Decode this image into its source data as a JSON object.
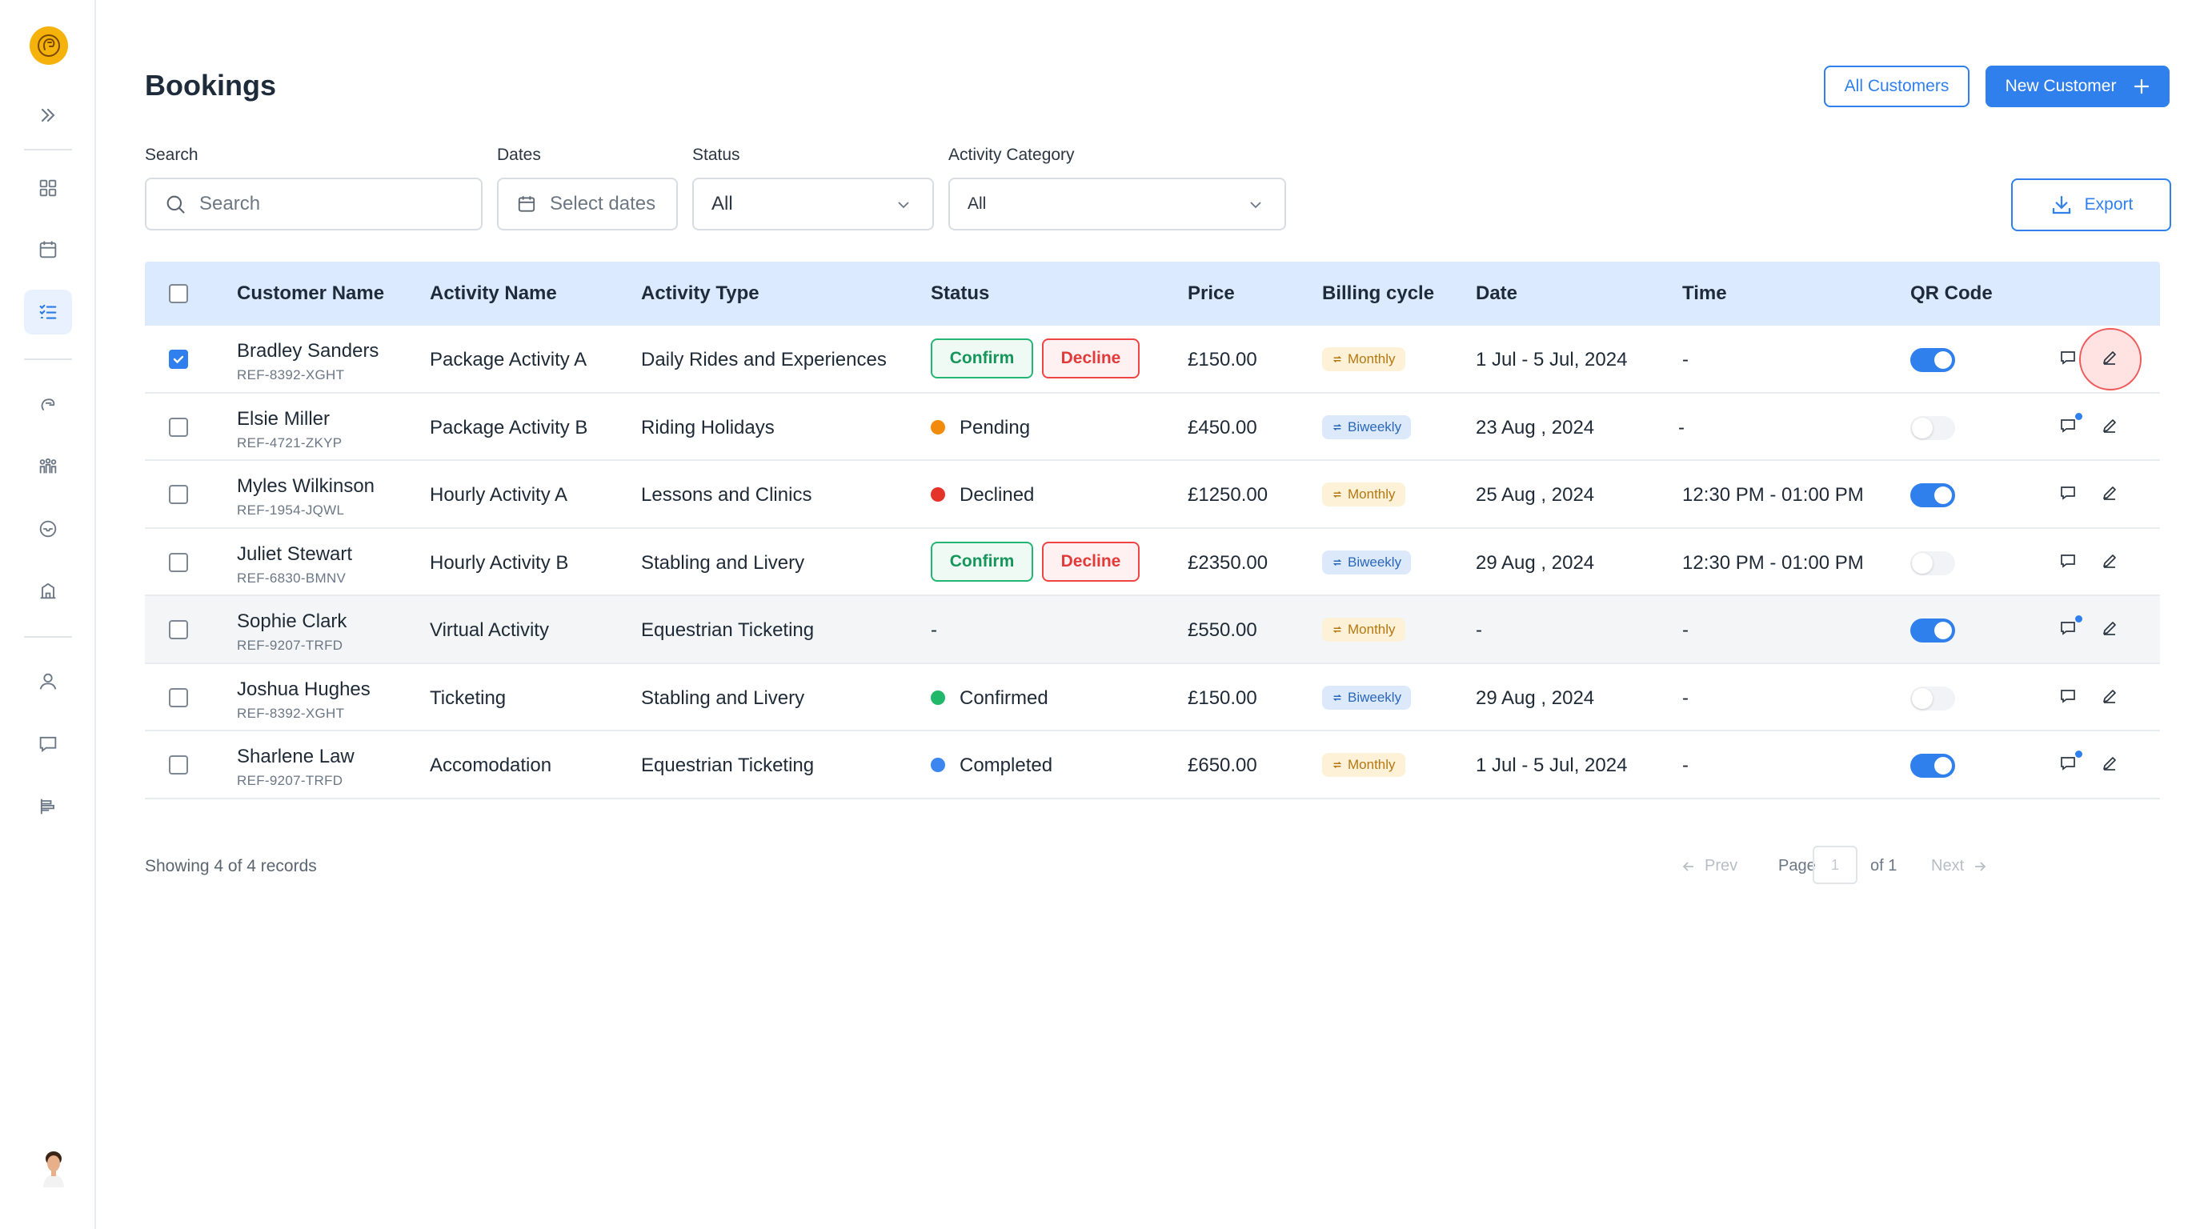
{
  "sidebar": {
    "items": [
      {
        "icon": "expand-icon"
      },
      {
        "icon": "dashboard-icon"
      },
      {
        "icon": "calendar-icon"
      },
      {
        "icon": "bookings-list-icon",
        "active": true
      },
      {
        "icon": "horse-icon"
      },
      {
        "icon": "people-group-icon"
      },
      {
        "icon": "inbox-icon"
      },
      {
        "icon": "building-icon"
      },
      {
        "icon": "user-icon"
      },
      {
        "icon": "message-icon"
      },
      {
        "icon": "reports-icon"
      }
    ]
  },
  "header": {
    "title": "Bookings",
    "all_customers_label": "All Customers",
    "new_customer_label": "New Customer"
  },
  "filters": {
    "search_label": "Search",
    "search_placeholder": "Search",
    "dates_label": "Dates",
    "dates_placeholder": "Select dates",
    "status_label": "Status",
    "status_value": "All",
    "category_label": "Activity Category",
    "category_value": "All",
    "export_label": "Export"
  },
  "table": {
    "columns": [
      "Customer Name",
      "Activity Name",
      "Activity Type",
      "Status",
      "Price",
      "Billing cycle",
      "Date",
      "Time",
      "QR Code"
    ],
    "confirm_label": "Confirm",
    "decline_label": "Decline",
    "rows": [
      {
        "name": "Bradley Sanders",
        "ref": "REF-8392-XGHT",
        "activity": "Package Activity A",
        "type": "Daily Rides and Experiences",
        "status": "action",
        "price": "£150.00",
        "billing": "Monthly",
        "date": "1 Jul - 5 Jul, 2024",
        "time": "-",
        "qr": true,
        "checked": true,
        "note": false
      },
      {
        "name": "Elsie Miller",
        "ref": "REF-4721-ZKYP",
        "activity": "Package Activity B",
        "type": "Riding Holidays",
        "status": "Pending",
        "price": "£450.00",
        "billing": "Biweekly",
        "date": "23 Aug , 2024",
        "time": "-",
        "qr": false,
        "checked": false,
        "note": true
      },
      {
        "name": "Myles Wilkinson",
        "ref": "REF-1954-JQWL",
        "activity": "Hourly Activity A",
        "type": "Lessons and Clinics",
        "status": "Declined",
        "price": "£1250.00",
        "billing": "Monthly",
        "date": "25 Aug , 2024",
        "time": "12:30 PM - 01:00 PM",
        "qr": true,
        "checked": false,
        "note": false
      },
      {
        "name": "Juliet Stewart",
        "ref": "REF-6830-BMNV",
        "activity": "Hourly Activity B",
        "type": "Stabling and Livery",
        "status": "action",
        "price": "£2350.00",
        "billing": "Biweekly",
        "date": "29 Aug , 2024",
        "time": "12:30 PM - 01:00 PM",
        "qr": false,
        "checked": false,
        "note": false
      },
      {
        "name": "Sophie Clark",
        "ref": "REF-9207-TRFD",
        "activity": "Virtual Activity",
        "type": "Equestrian Ticketing",
        "status": "-",
        "price": "£550.00",
        "billing": "Monthly",
        "date": "-",
        "time": "-",
        "qr": true,
        "checked": false,
        "note": true
      },
      {
        "name": "Joshua Hughes",
        "ref": "REF-8392-XGHT",
        "activity": "Ticketing",
        "type": "Stabling and Livery",
        "status": "Confirmed",
        "price": "£150.00",
        "billing": "Biweekly",
        "date": "29 Aug , 2024",
        "time": "-",
        "qr": false,
        "checked": false,
        "note": false
      },
      {
        "name": "Sharlene Law",
        "ref": "REF-9207-TRFD",
        "activity": "Accomodation",
        "type": "Equestrian Ticketing",
        "status": "Completed",
        "price": "£650.00",
        "billing": "Monthly",
        "date": "1 Jul - 5 Jul, 2024",
        "time": "-",
        "qr": true,
        "checked": false,
        "note": true
      }
    ]
  },
  "status_colors": {
    "Pending": "#f28a0c",
    "Declined": "#e5332a",
    "Confirmed": "#22b86a",
    "Completed": "#3b86ef"
  },
  "footer": {
    "showing": "Showing 4 of 4 records",
    "prev": "Prev",
    "page_label": "Page",
    "page_value": "1",
    "of_label": "of 1",
    "next": "Next"
  }
}
